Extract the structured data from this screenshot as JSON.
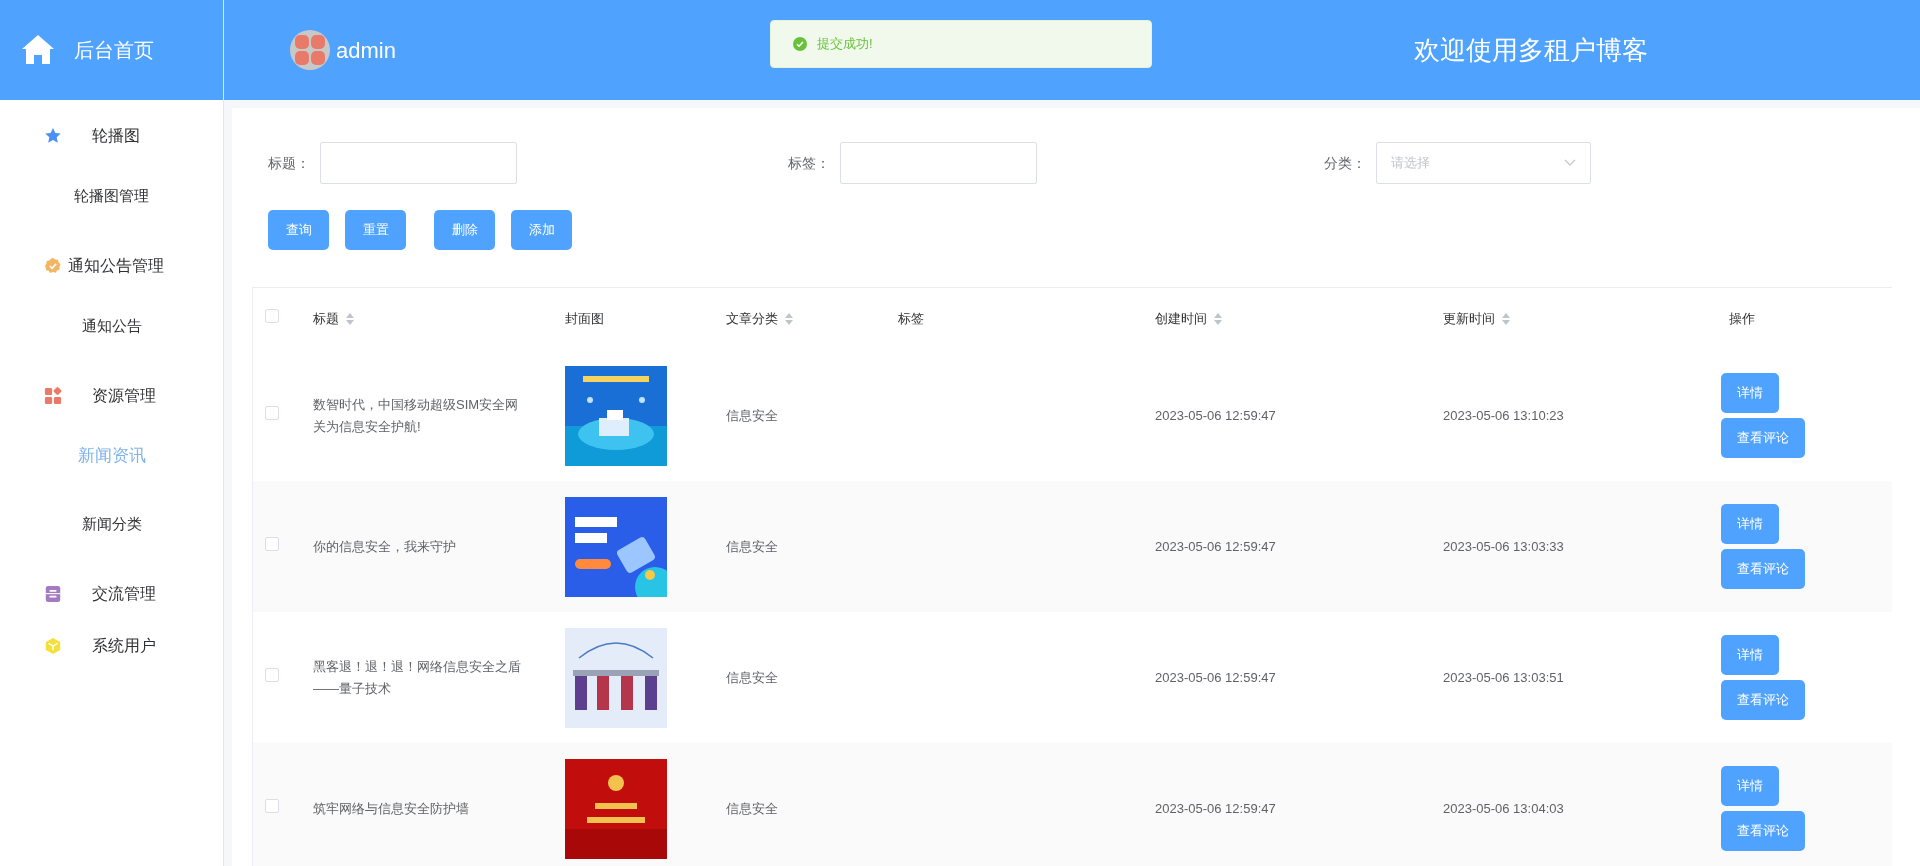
{
  "sidebar": {
    "home": "后台首页",
    "groups": [
      {
        "label": "轮播图",
        "children": [
          {
            "label": "轮播图管理",
            "selected": false
          }
        ]
      },
      {
        "label": "通知公告管理",
        "children": [
          {
            "label": "通知公告",
            "selected": false
          }
        ]
      },
      {
        "label": "资源管理",
        "children": [
          {
            "label": "新闻资讯",
            "selected": true
          },
          {
            "label": "新闻分类",
            "selected": false
          }
        ]
      },
      {
        "label": "交流管理"
      },
      {
        "label": "系统用户"
      }
    ]
  },
  "header": {
    "user": "admin",
    "welcome": "欢迎使用多租户博客"
  },
  "toast": {
    "kind": "success",
    "message": "提交成功!"
  },
  "filters": [
    {
      "label": "标题：",
      "kind": "text"
    },
    {
      "label": "标签：",
      "kind": "text"
    },
    {
      "label": "分类：",
      "kind": "select",
      "placeholder": "请选择"
    }
  ],
  "actions": [
    "查询",
    "重置",
    "删除",
    "添加"
  ],
  "table": {
    "select_all_checked": false,
    "columns": [
      {
        "label": "标题",
        "sortable": true
      },
      {
        "label": "封面图",
        "sortable": false
      },
      {
        "label": "文章分类",
        "sortable": true
      },
      {
        "label": "标签",
        "sortable": false
      },
      {
        "label": "创建时间",
        "sortable": true
      },
      {
        "label": "更新时间",
        "sortable": true
      },
      {
        "label": "操作",
        "sortable": false
      }
    ],
    "rows": [
      {
        "checked": false,
        "title": "数智时代，中国移动超级SIM安全网关为信息安全护航!",
        "category": "信息安全",
        "created": "2023-05-06 12:59:47",
        "updated": "2023-05-06 13:10:23",
        "buttons": [
          "详情",
          "查看评论"
        ]
      },
      {
        "checked": false,
        "title": "你的信息安全，我来守护",
        "category": "信息安全",
        "created": "2023-05-06 12:59:47",
        "updated": "2023-05-06 13:03:33",
        "buttons": [
          "详情",
          "查看评论"
        ]
      },
      {
        "checked": false,
        "title": "黑客退！退！退！网络信息安全之盾——量子技术",
        "category": "信息安全",
        "created": "2023-05-06 12:59:47",
        "updated": "2023-05-06 13:03:51",
        "buttons": [
          "详情",
          "查看评论"
        ]
      },
      {
        "checked": false,
        "title": "筑牢网络与信息安全防护墙",
        "category": "信息安全",
        "created": "2023-05-06 12:59:47",
        "updated": "2023-05-06 13:04:03",
        "buttons": [
          "详情",
          "查看评论"
        ]
      }
    ]
  }
}
